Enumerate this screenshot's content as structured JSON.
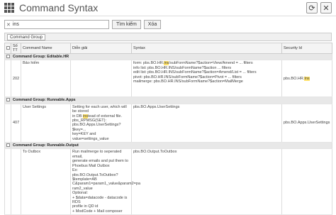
{
  "window": {
    "title": "Command Syntax"
  },
  "toolbar": {
    "refresh_icon": "refresh-icon",
    "close_icon": "close-icon"
  },
  "search": {
    "value": "ins",
    "search_label": "Tìm kiếm",
    "clear_label": "Xóa"
  },
  "grouping": {
    "chip": "Command Group"
  },
  "columns": {
    "no": "Số TT",
    "name": "Command Name",
    "desc": "Diễn giải",
    "syntax": "Syntax",
    "security": "Security Id"
  },
  "groups": [
    {
      "label": "Command Group: Editable.HR",
      "rows": [
        {
          "no": "202",
          "name": "Bảo hiểm",
          "desc": [],
          "syntax": [
            [
              "form: pbs.BO.HR.",
              "ins",
              "/subFormName?$action=View/Amend = ... filters"
            ],
            [
              "info list: pbs.BO.HR.INS/subFormName?$action ... filters"
            ],
            [
              "edit list: pbs.BO.HR.INS/subFormName?$action=Amend/List = ... filters"
            ],
            [
              "pivot: pbs.BO.HR.INS/subFormName?$action=Pivot = ... filters"
            ],
            [
              "mailmerge: pbs.BO.HR.INS/subFormName?$action=MailMerge"
            ]
          ],
          "security": [
            "pbs.BO.HR.",
            "Ins",
            ""
          ]
        }
      ]
    },
    {
      "label": "Command Group: Runnable.Apps",
      "rows": [
        {
          "no": "407",
          "name": "User Settings",
          "desc": [
            [
              "Setting for each user, which will be stored"
            ],
            [
              "in DB ",
              "ins",
              "tead of external file."
            ],
            [
              "pbs_RPMSG(SET):"
            ],
            [
              "pbs.BO.Apps.UserSettings?$key=..."
            ],
            [
              "key=KEY and value=settings_value"
            ]
          ],
          "syntax": [
            [
              "pbs.BO.Apps.UserSettings"
            ]
          ],
          "security": [
            "pbs.BO.Apps.UserSettings",
            "",
            ""
          ]
        }
      ]
    },
    {
      "label": "Command Group: Runnable.Output",
      "rows": [
        {
          "no": "",
          "name": "To Outbox",
          "desc": [
            [
              "Run mailmerge to seperated email,"
            ],
            [
              "generate emails and put them to"
            ],
            [
              "Phoebus Mail Outbox"
            ],
            [
              "Ex:"
            ],
            [
              "pbs.BO.Output.ToOutbox?$template=AB"
            ],
            [
              "C&param1=param1_value&param2=pa"
            ],
            [
              "ram2_value"
            ],
            [
              "Optional:"
            ],
            [
              "+ $data=datacode - datacode is RDS"
            ],
            [
              "profile in QD id"
            ],
            [
              "+ ModCode + Mail composer"
            ]
          ],
          "syntax": [
            [
              "pbs.BO.Output.ToOutbox"
            ]
          ],
          "security": [
            "",
            "",
            ""
          ]
        }
      ]
    }
  ]
}
